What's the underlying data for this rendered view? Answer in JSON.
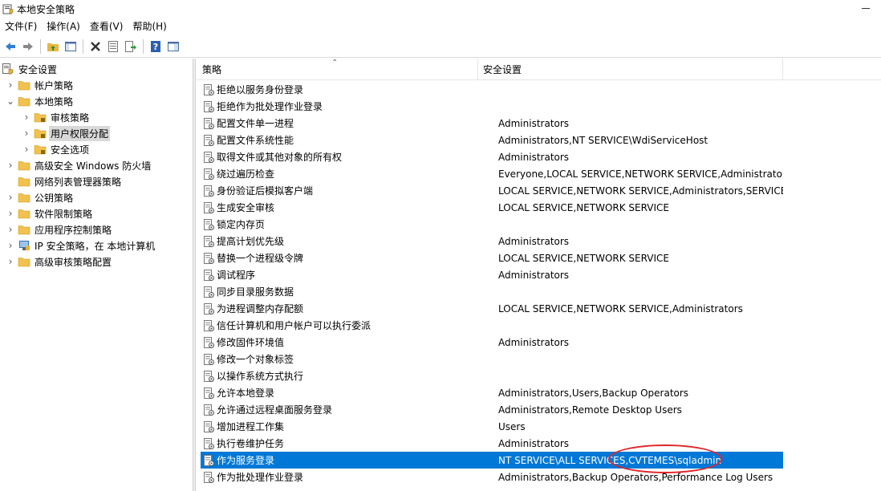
{
  "window": {
    "title": "本地安全策略"
  },
  "menu": [
    "文件(F)",
    "操作(A)",
    "查看(V)",
    "帮助(H)"
  ],
  "toolbar": {
    "icons": [
      "back-arrow-icon",
      "forward-arrow-icon",
      "up-folder-icon",
      "show-hide-tree-icon",
      "delete-icon",
      "properties-icon",
      "export-list-icon",
      "help-icon",
      "view-icon"
    ]
  },
  "tree": [
    {
      "label": "安全设置",
      "level": 0,
      "expander": "",
      "icon": "security-settings"
    },
    {
      "label": "帐户策略",
      "level": 1,
      "expander": "›",
      "icon": "folder"
    },
    {
      "label": "本地策略",
      "level": 1,
      "expander": "⌄",
      "icon": "folder"
    },
    {
      "label": "审核策略",
      "level": 2,
      "expander": "›",
      "icon": "folder"
    },
    {
      "label": "用户权限分配",
      "level": 2,
      "expander": "›",
      "icon": "folder",
      "selected": true
    },
    {
      "label": "安全选项",
      "level": 2,
      "expander": "›",
      "icon": "folder"
    },
    {
      "label": "高级安全 Windows 防火墙",
      "level": 1,
      "expander": "›",
      "icon": "folder"
    },
    {
      "label": "网络列表管理器策略",
      "level": 1,
      "expander": "",
      "icon": "folder"
    },
    {
      "label": "公钥策略",
      "level": 1,
      "expander": "›",
      "icon": "folder"
    },
    {
      "label": "软件限制策略",
      "level": 1,
      "expander": "›",
      "icon": "folder"
    },
    {
      "label": "应用程序控制策略",
      "level": 1,
      "expander": "›",
      "icon": "folder"
    },
    {
      "label": "IP 安全策略，在 本地计算机",
      "level": 1,
      "expander": "›",
      "icon": "ip-security"
    },
    {
      "label": "高级审核策略配置",
      "level": 1,
      "expander": "›",
      "icon": "folder"
    }
  ],
  "columns": {
    "policy": "策略",
    "setting": "安全设置"
  },
  "rows": [
    {
      "policy": "拒绝以服务身份登录",
      "setting": ""
    },
    {
      "policy": "拒绝作为批处理作业登录",
      "setting": ""
    },
    {
      "policy": "配置文件单一进程",
      "setting": "Administrators"
    },
    {
      "policy": "配置文件系统性能",
      "setting": "Administrators,NT SERVICE\\WdiServiceHost"
    },
    {
      "policy": "取得文件或其他对象的所有权",
      "setting": "Administrators"
    },
    {
      "policy": "绕过遍历检查",
      "setting": "Everyone,LOCAL SERVICE,NETWORK SERVICE,Administrators,..."
    },
    {
      "policy": "身份验证后模拟客户端",
      "setting": "LOCAL SERVICE,NETWORK SERVICE,Administrators,SERVICE"
    },
    {
      "policy": "生成安全审核",
      "setting": "LOCAL SERVICE,NETWORK SERVICE"
    },
    {
      "policy": "锁定内存页",
      "setting": ""
    },
    {
      "policy": "提高计划优先级",
      "setting": "Administrators"
    },
    {
      "policy": "替换一个进程级令牌",
      "setting": "LOCAL SERVICE,NETWORK SERVICE"
    },
    {
      "policy": "调试程序",
      "setting": "Administrators"
    },
    {
      "policy": "同步目录服务数据",
      "setting": ""
    },
    {
      "policy": "为进程调整内存配额",
      "setting": "LOCAL SERVICE,NETWORK SERVICE,Administrators"
    },
    {
      "policy": "信任计算机和用户帐户可以执行委派",
      "setting": ""
    },
    {
      "policy": "修改固件环境值",
      "setting": "Administrators"
    },
    {
      "policy": "修改一个对象标签",
      "setting": ""
    },
    {
      "policy": "以操作系统方式执行",
      "setting": ""
    },
    {
      "policy": "允许本地登录",
      "setting": "Administrators,Users,Backup Operators"
    },
    {
      "policy": "允许通过远程桌面服务登录",
      "setting": "Administrators,Remote Desktop Users"
    },
    {
      "policy": "增加进程工作集",
      "setting": "Users"
    },
    {
      "policy": "执行卷维护任务",
      "setting": "Administrators"
    },
    {
      "policy": "作为服务登录",
      "setting": "NT SERVICE\\ALL SERVICES,CVTEMES\\sqladmin",
      "selected": true
    },
    {
      "policy": "作为批处理作业登录",
      "setting": "Administrators,Backup Operators,Performance Log Users"
    }
  ],
  "colors": {
    "selection": "#0078d7",
    "tree_selection": "#d9d9d9",
    "annotation": "#e0262a",
    "folder": "#f2c24e"
  }
}
